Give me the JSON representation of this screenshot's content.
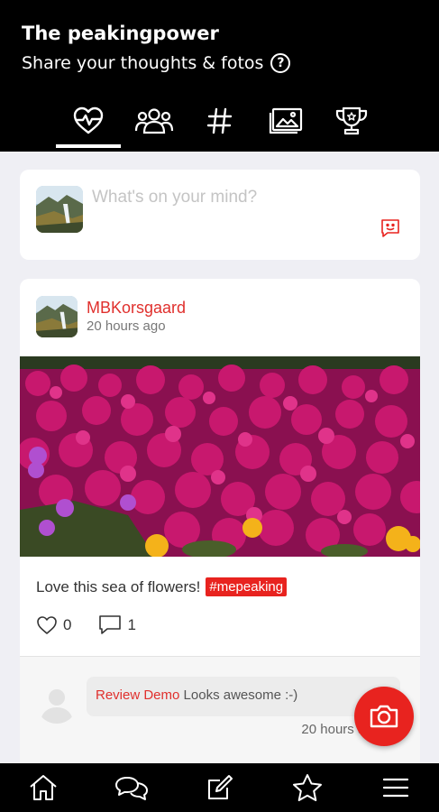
{
  "header": {
    "title": "The peakingpower",
    "subtitle": "Share your thoughts & fotos",
    "help_symbol": "?"
  },
  "tabs": [
    {
      "icon": "heartbeat-icon",
      "active": true
    },
    {
      "icon": "group-icon",
      "active": false
    },
    {
      "icon": "hashtag-icon",
      "active": false
    },
    {
      "icon": "gallery-icon",
      "active": false
    },
    {
      "icon": "trophy-icon",
      "active": false
    }
  ],
  "composer": {
    "placeholder": "What's on your mind?",
    "emoji_icon": "smiley-icon"
  },
  "post": {
    "username": "MBKorsgaard",
    "time": "20 hours ago",
    "caption": "Love this sea of flowers!",
    "hashtag": "#mepeaking",
    "likes": "0",
    "comments": "1",
    "comment": {
      "author": "Review Demo",
      "text": "Looks awesome :-)",
      "time": "20 hours ago"
    }
  },
  "colors": {
    "accent": "#e8231f",
    "header_bg": "#000000",
    "page_bg": "#efeff4"
  },
  "bottom_nav": [
    {
      "icon": "home-icon"
    },
    {
      "icon": "chat-icon"
    },
    {
      "icon": "edit-icon"
    },
    {
      "icon": "star-icon"
    },
    {
      "icon": "menu-icon"
    }
  ]
}
